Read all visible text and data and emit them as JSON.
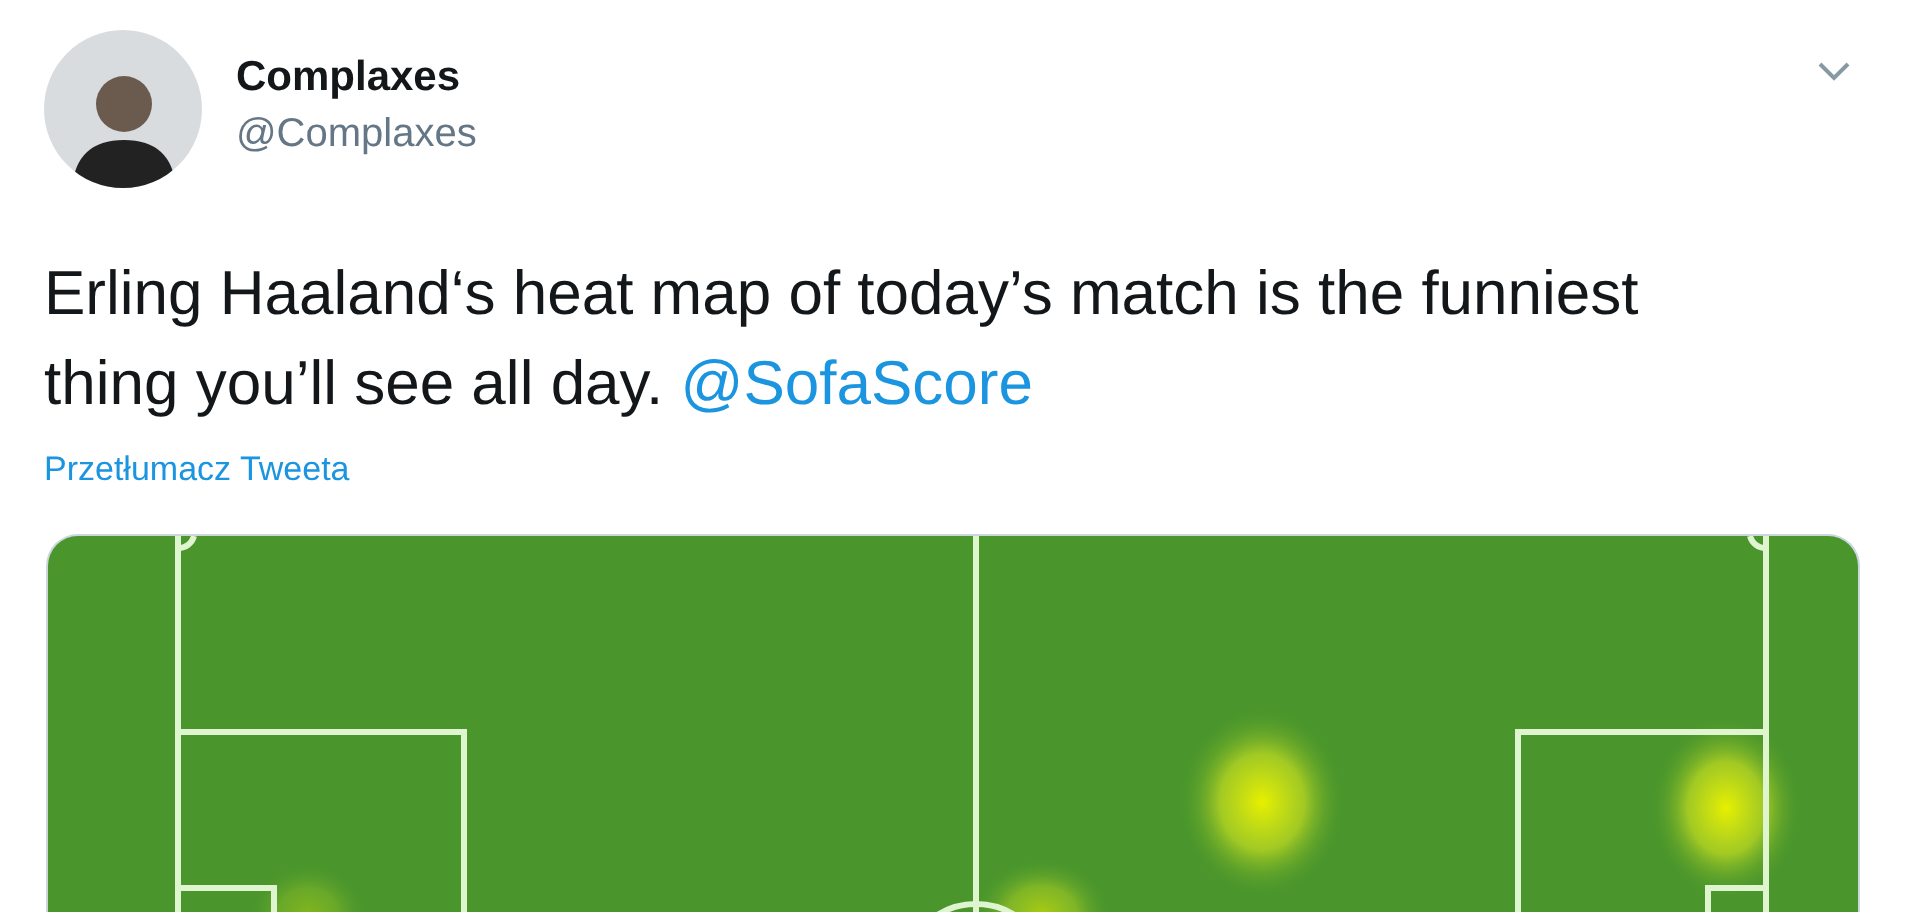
{
  "author": {
    "name": "Complaxes",
    "handle": "@Complaxes"
  },
  "tweet": {
    "text": "Erling Haaland‘s heat map of today’s match is the funniest thing you’ll see all day.",
    "mention": "@SofaScore"
  },
  "translate_link": "Przetłumacz Tweeta"
}
